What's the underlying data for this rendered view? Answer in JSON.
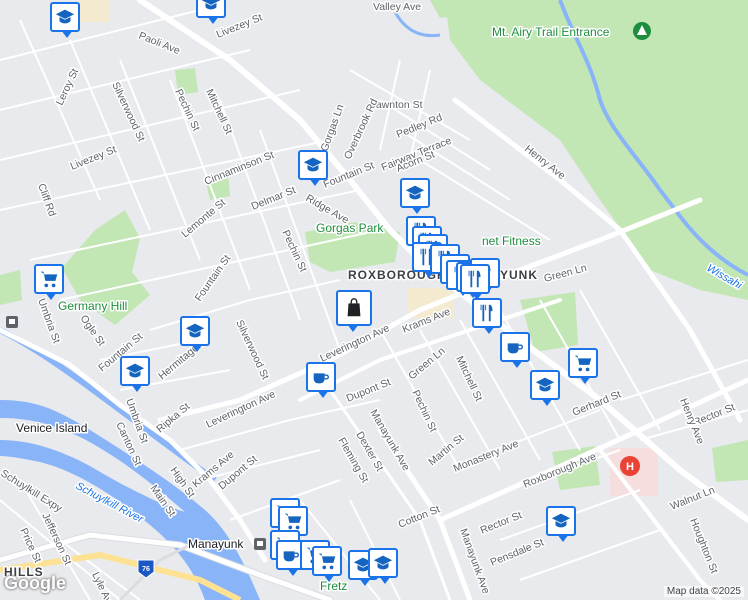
{
  "map": {
    "streets": {
      "valley_ave": "Valley Ave",
      "paoli_ave": "Paoli Ave",
      "livezey_st_top": "Livezey St",
      "leroy_st": "Leroy St",
      "silverwood_st_top": "Silverwood St",
      "pechin_st_top": "Pechin St",
      "mitchell_st_top": "Mitchell St",
      "lawnton_st": "Lawnton St",
      "overbrook_rd": "Overbrook Rd",
      "pedley_rd": "Pedley Rd",
      "gorgas_ln": "Gorgas Ln",
      "fairway_terrace": "Fairway Terrace",
      "livezey_st_left": "Livezey St",
      "cinnaminson_st": "Cinnaminson St",
      "fountain_st_top": "Fountain St",
      "acorn_st": "Acorn St",
      "cliff_rd": "Cliff Rd",
      "delmar_st": "Delmar St",
      "lemonte_st": "Lemonte St",
      "ridge_ave": "Ridge Ave",
      "henry_ave_top": "Henry Ave",
      "pechin_st_mid": "Pechin St",
      "fountain_st_mid": "Fountain St",
      "silverwood_st_mid": "Silverwood St",
      "leverington_ave_top": "Leverington Ave",
      "krams_ave_top": "Krams Ave",
      "green_ln_top": "Green Ln",
      "umbria_st_left": "Umbria St",
      "ogle_st": "Ogle St",
      "fountain_st_low": "Fountain St",
      "hermitage_st": "Hermitage St",
      "dupont_st_mid": "Dupont St",
      "green_ln_mid": "Green Ln",
      "mitchell_st_mid": "Mitchell St",
      "pechin_st_low": "Pechin St",
      "leverington_ave_low": "Leverington Ave",
      "ripka_st": "Ripka St",
      "umbria_st_low": "Umbria St",
      "canton_st": "Canton St",
      "dexter_st": "Dexter St",
      "fleming_st": "Fleming St",
      "martin_st": "Martin St",
      "monastery_ave": "Monastery Ave",
      "gerhard_st": "Gerhard St",
      "rector_st_right": "Rector St",
      "henry_ave_low": "Henry Ave",
      "roxborough_ave": "Roxborough Ave",
      "manayunk_ave_mid": "Manayunk Ave",
      "high_st": "High St",
      "krams_ave_low": "Krams Ave",
      "dupont_st_low": "Dupont St",
      "main_st": "Main St",
      "walnut_ln": "Walnut Ln",
      "cotton_st": "Cotton St",
      "rector_st_low": "Rector St",
      "pensdale_st": "Pensdale St",
      "jefferson_st": "Jefferson St",
      "price_st": "Price St",
      "lyle_ave": "Lyle Ave",
      "manayunk_ave_low": "Manayunk Ave",
      "houghton_st": "Houghton St",
      "schuylkill_expy": "Schuylkill Expy",
      "highway_shield": "76"
    },
    "places": {
      "gorgas_park": "Gorgas Park",
      "germany_hill": "Germany Hill",
      "venice_island": "Venice Island",
      "roxborough": "ROXBOROUGH",
      "manayunk_area": "YUNK",
      "manayunk_station": "Manayunk",
      "planet_fitness": "net Fitness",
      "mt_airy_trail": "Mt. Airy Trail Entrance",
      "wissahickon": "Wissahi",
      "schuylkill_river": "Schuylkill River",
      "hills": "HILLS",
      "fretz": "Fretz"
    },
    "colors": {
      "road": "#ffffff",
      "land": "#e8eaed",
      "park": "#c3e6b5",
      "water": "#8ab4f8",
      "marker_border": "#1a73e8",
      "icon": "#1565c0"
    }
  },
  "footer": {
    "logo": "Google",
    "attribution": "Map data ©2025"
  }
}
